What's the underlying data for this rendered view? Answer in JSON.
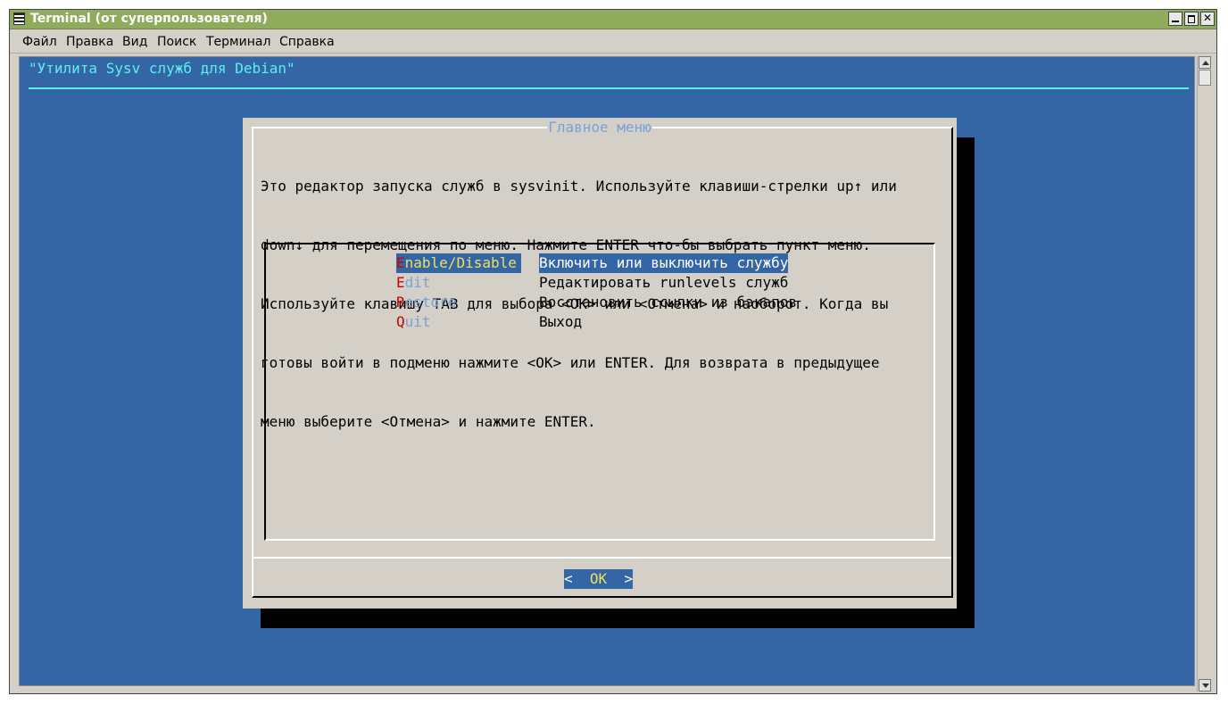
{
  "window": {
    "title": "Terminal (от суперпользователя)"
  },
  "menubar": {
    "items": [
      "Файл",
      "Правка",
      "Вид",
      "Поиск",
      "Терминал",
      "Справка"
    ]
  },
  "terminal": {
    "backtitle": "\"Утилита Sysv служб для Debian\"",
    "dialog": {
      "title": "Главное меню",
      "text_lines": [
        "Это редактор запуска служб в sysvinit. Используйте клавиши-стрелки up↑ или",
        "down↓ для перемещения по меню. Нажмите ENTER что-бы выбрать пункт меню.",
        "Используйте клавишу TAB для выбора <OK> или <Отмена> и наоборот. Когда вы",
        "готовы войти в подменю нажмите <OK> или ENTER. Для возврата в предыдущее",
        "меню выберите <Отмена> и нажмите ENTER."
      ],
      "menu_items": [
        {
          "hotkey": "E",
          "rest": "nable/Disable",
          "description": "Включить или выключить службу",
          "selected": true
        },
        {
          "hotkey": "E",
          "rest": "dit",
          "description": "Редактировать runlevels служб",
          "selected": false
        },
        {
          "hotkey": "R",
          "rest": "estore",
          "description": "Восстановить ссылки из бэкапов",
          "selected": false
        },
        {
          "hotkey": "Q",
          "rest": "uit",
          "description": "Выход",
          "selected": false
        }
      ],
      "ok_button": {
        "left": "<",
        "label": "OK",
        "right": ">"
      }
    }
  },
  "colors": {
    "titlebar": "#8fab5c",
    "terminal_bg": "#3465a4",
    "backtitle": "#5cf0f0",
    "dialog_bg": "#d4d0c8",
    "hotkey": "#cc0000",
    "selected_tag": "#f0e05a"
  }
}
